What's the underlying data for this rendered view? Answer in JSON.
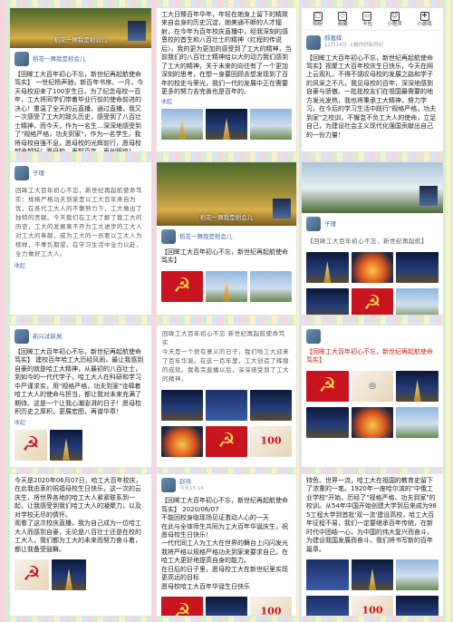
{
  "p1": {
    "banner_caption": "稻花一舞我是稻公儿",
    "username": "稻花一舞我是稻会儿",
    "text": "【回眸工大百年初心不忘，新世纪再起航使命笃实】 一世纪杨声驰，新百年书序。一月，今天母校迎来了100岁生日，为了纪念母校一百年，工大将同学们带着毕业行前的使命前进的决心！重温了全天的云直播，通过直播，我又一次感受了工大的致久历史，感受到了八百壮士精神，而今天，作为一名生…深深地感受到了\"规格严格，功夫到家\"，作为一名学生，我将母校自强不息，愿母校的光辉前行，愿母校越来越好！愿母校，再起百年，再创辉煌！",
    "more": "收起"
  },
  "p2": {
    "text": "工大日臻百年华年，年轻在她身上留下的精致来自会身的历史沉淀，她美通不断的人才辐射，在今年为百年校庆直播中，经我深刻的感恩校的首生和八百壮士的精神〈红程的传说后〉，我的更为更加的感受到了工大的精神，当前我们的八百壮士精神给以大的动力我们感到了工大的精神，关于未来的向往有了一个更加深刻的思考，在想一身要回顾去想发现到了百年的校史与荣光，我们一代的发展中正在需要更多的努力去完善也是百年的。",
    "more": "收起"
  },
  "p3": {
    "icons": [
      "相册",
      "收藏",
      "卡包",
      "小程序",
      "小游戏"
    ],
    "username": "郝嘉辉",
    "meta": "12月14日  上报你好新世纪",
    "text": "【回眸工大百年初心不忘，新世纪再起航使命笃实】视聚工大百年校庆生日快乐，今天在网上云观礼，不得不感叹母校的发展之路和学子的风采之不凡，我见母校的百年，深深地感到自豪与骄傲。一批批校友们在祖国最需要的地方发光发热，我也将秉承工大精神，努力学习，在今后的学习生活中践行\"规格严格，功夫到家\"之校训，不懈怠不负工大人的使命，立足自己，为建设社会主义现代化强国贡献出自己的一份力量！"
  },
  "p4": {
    "username": "子瑾",
    "text": "回眸工大百年初心不忘，新世纪再起航使命笃实：规格严格功夫到家是以工大百年来自为忧，在各代工大人的不懈努力下，工大做出了独特的贡献。今天我们在工大了解了我工大的历史，工大的发展离不开为工大进步的工大人对工大的奉献，成为工大的一员要以工大人为榜样，不辜负期望，在学习生活中全力以赴，全力做好工大人。",
    "more": "收起"
  },
  "p5": {
    "banner_caption": "稻花一舞我是稻会儿",
    "username": "稻花一舞我是稻会儿",
    "text": "【回眸工大百年初心不忘，新世纪再起航使命笃实】"
  },
  "p6": {
    "username": "子瑾",
    "text": "【回眸工大百年初心不忘，新世纪再起航】"
  },
  "p7": {
    "username": "新兴试新展",
    "text": "【回眸工大百年初心不忘，新世纪再起航使命笃实】 建校百年哈工大历经风雨，最让我感到自豪的就是哈工大精神，从最初的八百壮士，到如今的一代代学子，哈工大人在科研和学习中严谨求实，用\"规格严格，功夫到家\"诠释着哈工大人的使命与担当，都让我对未来充满了期待。这是一个让我心潮澎湃的日子！愿母校积历史之厚积，更展宏图，再谱华章！",
    "more": "收起"
  },
  "p8": {
    "text": "回眸工大百年初心不忘 新世纪再起航使命笃实\n今天是一个很有意义的日子，我们哈工大迎来了百年华诞。在这一百年里，工大创造了辉煌的成就。我看完直播以后，深深感受到了工大的精神。"
  },
  "p9": {
    "text": "【回眸工大百年初心不忘，新世纪再起航使命笃实】"
  },
  "p10": {
    "text": "今天是2020年06月07日，哈工大百年校庆，在此我由衷的祝福母校生日快乐，这一次的云庆生，将世界各地的哈工大人紧紧联系到一起，让我感受到我们哈工大人的凝聚力，以及对学校无尽的情怀。\n观看了这次校庆直播，我为自己成为一位哈工大人而感到自豪，无论是八百壮士还是在校的工大人，我们都为工大的未来而努力奋斗着，都让我备受鼓舞。"
  },
  "p11": {
    "username": "赵琦",
    "meta": "今天15:16",
    "text": "【回眸工大百年初心不忘，新世纪再起航使命笃实】 2020/06/07\n不能回校身临现场见证激动人心的一天\n在此与全体师生共同为工大百年华诞庆生，祝愿母校生日快乐！\n一代代同工人为工大在世界的舞台上闪闪发光\n我将严格以规格严格功夫到家来要求自己，在哈工大更好地提高自身的能力。\n在日后的日子里，愿母校工大在新世纪里实现更高远的目标\n愿母校哈工大百年华诞生日快乐"
  },
  "p12": {
    "text": "特色、世界一流，哈工大在祖国的教育史留下了浓重的一笔。1920年一座哈尔滨的\"中俄工业学校\"开始，历经了\"规格严格、功夫到家\"的校训。从54年中国开始创建大学到后来成为985工程大学到首批'双一流'建设高校，哈工大百年征程不易，我们一定要继承百年传统，在新时代中团结一心，为中国的伟大复兴而奋斗，为建设我国发展而奋斗，我们将书写新的百年篇章。"
  }
}
